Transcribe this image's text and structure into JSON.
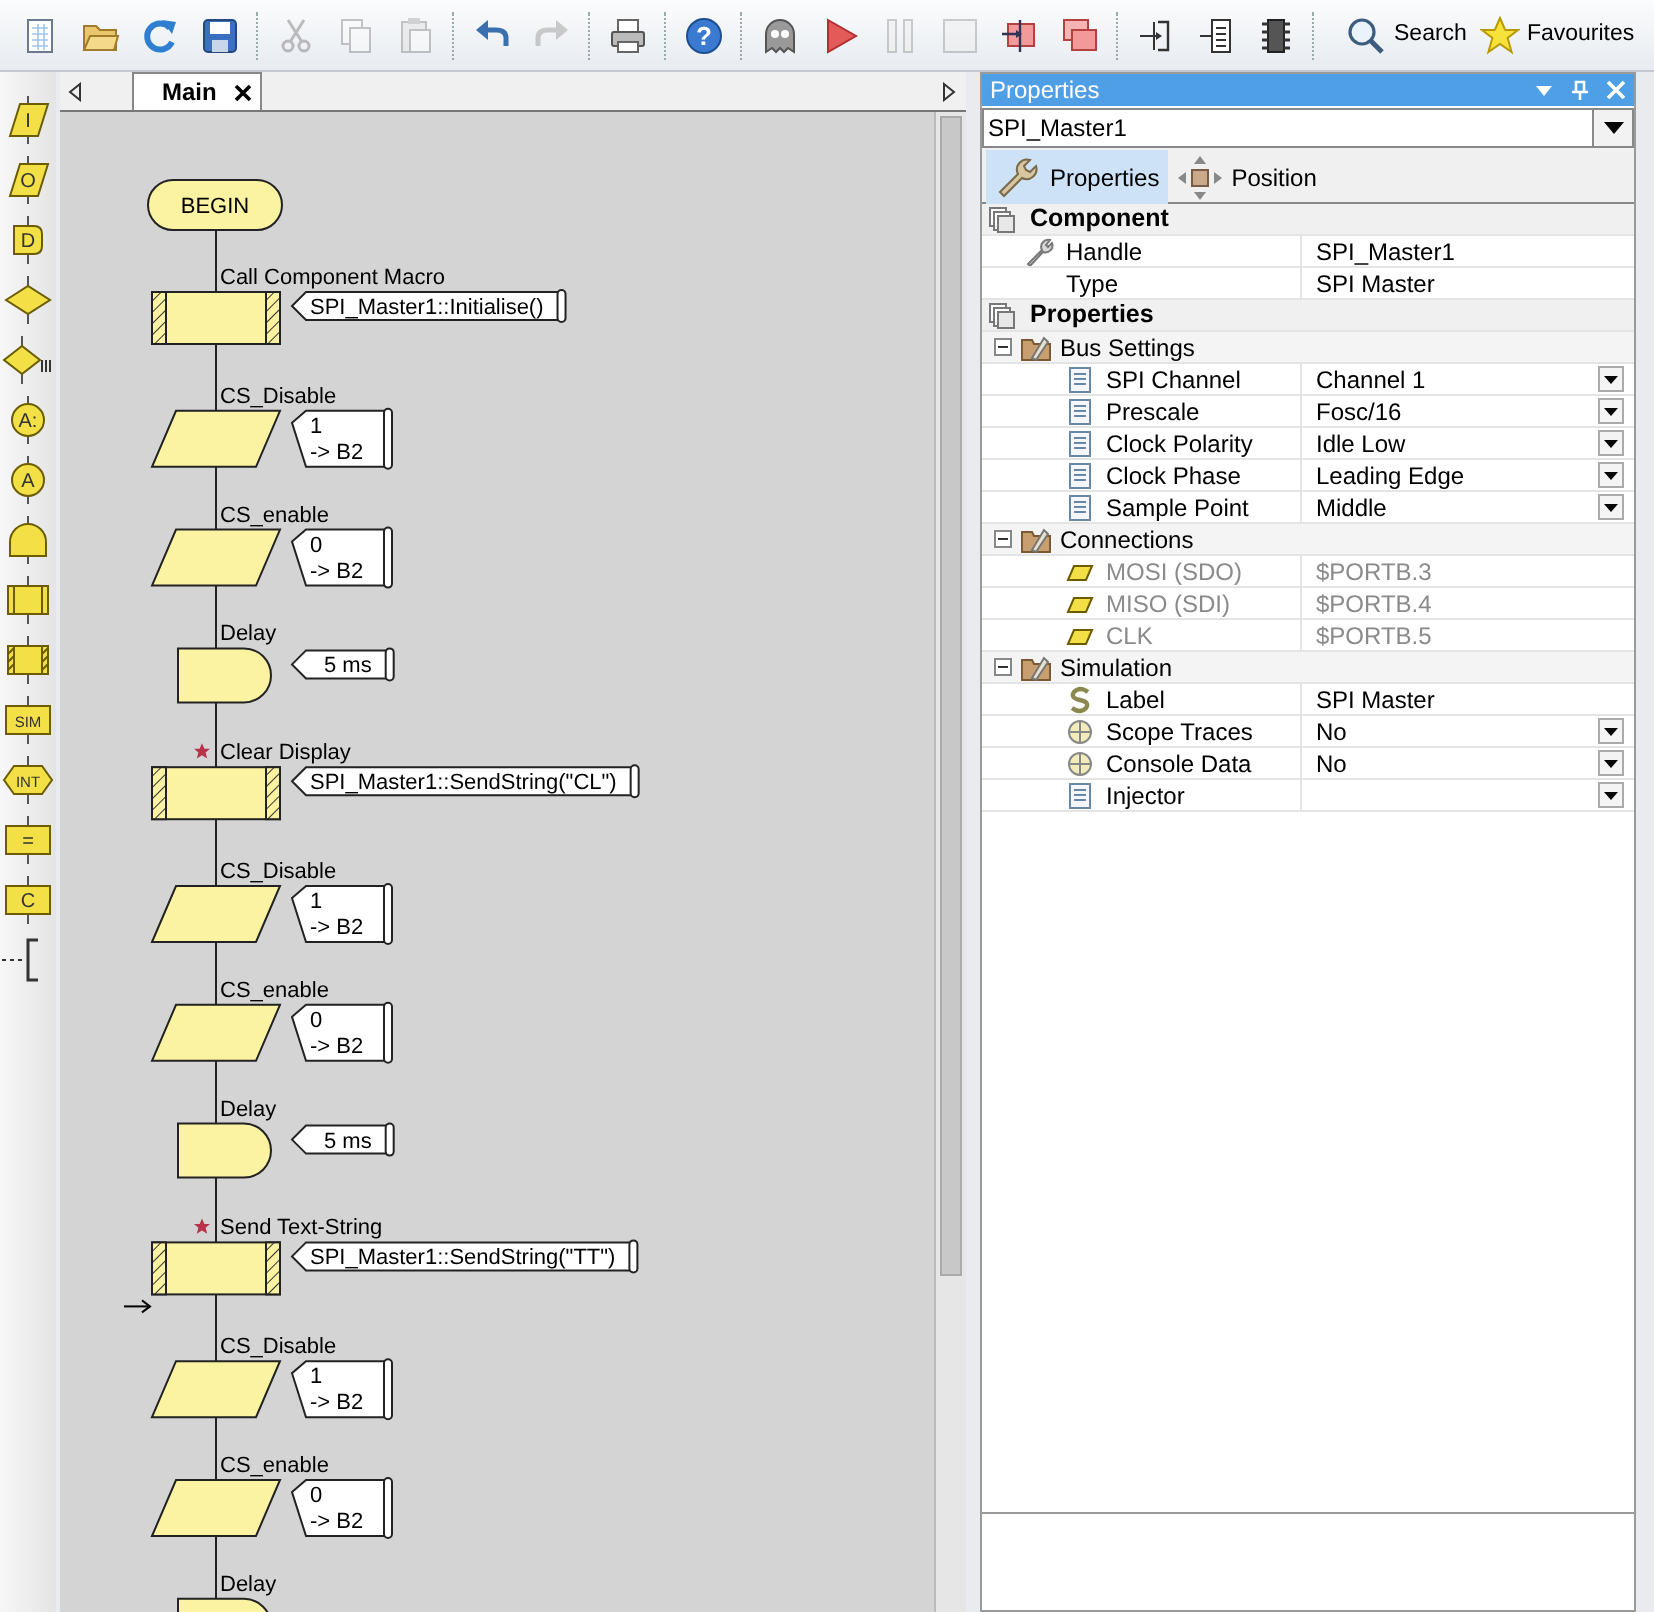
{
  "toolbar": [
    {
      "kind": "new",
      "disabled": false
    },
    {
      "kind": "open",
      "disabled": false
    },
    {
      "kind": "refresh",
      "disabled": false
    },
    {
      "kind": "save",
      "disabled": false
    },
    {
      "kind": "separator"
    },
    {
      "kind": "cut",
      "disabled": true
    },
    {
      "kind": "copy",
      "disabled": true
    },
    {
      "kind": "paste",
      "disabled": true
    },
    {
      "kind": "separator"
    },
    {
      "kind": "undo",
      "disabled": false
    },
    {
      "kind": "redo",
      "disabled": true
    },
    {
      "kind": "separator"
    },
    {
      "kind": "print",
      "disabled": false
    },
    {
      "kind": "separator"
    },
    {
      "kind": "help",
      "disabled": false,
      "glyph": "?"
    },
    {
      "kind": "separator"
    },
    {
      "kind": "ghost",
      "disabled": false
    },
    {
      "kind": "run",
      "disabled": false
    },
    {
      "kind": "pause",
      "disabled": true
    },
    {
      "kind": "stop",
      "disabled": true
    },
    {
      "kind": "step-into",
      "disabled": false
    },
    {
      "kind": "step-over",
      "disabled": false
    },
    {
      "kind": "separator"
    },
    {
      "kind": "port-in",
      "disabled": false
    },
    {
      "kind": "port-out",
      "disabled": false
    },
    {
      "kind": "chip",
      "disabled": false
    },
    {
      "kind": "separator"
    },
    {
      "kind": "search",
      "disabled": false,
      "label": "Search"
    },
    {
      "kind": "favourites",
      "disabled": false,
      "label": "Favourites"
    }
  ],
  "palette": [
    {
      "kind": "parallelogram",
      "glyph": "I"
    },
    {
      "kind": "parallelogram",
      "glyph": "O"
    },
    {
      "kind": "tag",
      "glyph": "D"
    },
    {
      "kind": "diamond"
    },
    {
      "kind": "switch"
    },
    {
      "kind": "circle",
      "glyph": "A:"
    },
    {
      "kind": "circle",
      "glyph": "A"
    },
    {
      "kind": "dome"
    },
    {
      "kind": "bars"
    },
    {
      "kind": "hatched"
    },
    {
      "kind": "box",
      "glyph": "SIM"
    },
    {
      "kind": "hexagon",
      "glyph": "INT"
    },
    {
      "kind": "box",
      "glyph": "="
    },
    {
      "kind": "box",
      "glyph": "C"
    },
    {
      "kind": "bracket"
    }
  ],
  "flowchart": {
    "tabs": [
      {
        "label": "Main",
        "selected": true
      }
    ],
    "begin": "BEGIN",
    "steps": [
      {
        "kind": "component_macro",
        "label": "Call Component Macro",
        "starred": false,
        "marker": false,
        "comment": [
          "SPI_Master1::Initialise()"
        ]
      },
      {
        "kind": "output",
        "label": "CS_Disable",
        "starred": false,
        "marker": false,
        "comment": [
          "1",
          "-> B2"
        ]
      },
      {
        "kind": "output",
        "label": "CS_enable",
        "starred": false,
        "marker": false,
        "comment": [
          "0",
          "-> B2"
        ]
      },
      {
        "kind": "delay",
        "label": "Delay",
        "starred": false,
        "marker": false,
        "comment": [
          "5 ms"
        ]
      },
      {
        "kind": "component_macro",
        "label": "Clear Display",
        "starred": true,
        "marker": false,
        "comment": [
          "SPI_Master1::SendString(\"CL\")"
        ]
      },
      {
        "kind": "output",
        "label": "CS_Disable",
        "starred": false,
        "marker": false,
        "comment": [
          "1",
          "-> B2"
        ]
      },
      {
        "kind": "output",
        "label": "CS_enable",
        "starred": false,
        "marker": false,
        "comment": [
          "0",
          "-> B2"
        ]
      },
      {
        "kind": "delay",
        "label": "Delay",
        "starred": false,
        "marker": false,
        "comment": [
          "5 ms"
        ]
      },
      {
        "kind": "component_macro",
        "label": "Send Text-String",
        "starred": true,
        "marker": true,
        "comment": [
          "SPI_Master1::SendString(\"TT\")"
        ]
      },
      {
        "kind": "output",
        "label": "CS_Disable",
        "starred": false,
        "marker": false,
        "comment": [
          "1",
          "-> B2"
        ]
      },
      {
        "kind": "output",
        "label": "CS_enable",
        "starred": false,
        "marker": false,
        "comment": [
          "0",
          "-> B2"
        ]
      },
      {
        "kind": "delay",
        "label": "Delay",
        "starred": false,
        "marker": false
      }
    ]
  },
  "properties": {
    "title": "Properties",
    "selector": "SPI_Master1",
    "tabs": [
      {
        "kind": "properties",
        "label": "Properties",
        "selected": true
      },
      {
        "kind": "position",
        "label": "Position",
        "selected": false
      }
    ],
    "sections": [
      {
        "title": "Component",
        "rows": [
          {
            "kind": "handle",
            "name": "Handle",
            "value": "SPI_Master1",
            "dropdown": false,
            "disabled": false
          },
          {
            "kind": "plain",
            "name": "Type",
            "value": "SPI Master",
            "dropdown": false,
            "disabled": false
          }
        ]
      },
      {
        "title": "Properties",
        "groups": [
          {
            "title": "Bus Settings",
            "expanded": true,
            "rows": [
              {
                "kind": "list",
                "name": "SPI Channel",
                "value": "Channel 1",
                "dropdown": true,
                "disabled": false
              },
              {
                "kind": "list",
                "name": "Prescale",
                "value": "Fosc/16",
                "dropdown": true,
                "disabled": false
              },
              {
                "kind": "list",
                "name": "Clock Polarity",
                "value": "Idle Low",
                "dropdown": true,
                "disabled": false
              },
              {
                "kind": "list",
                "name": "Clock Phase",
                "value": "Leading Edge",
                "dropdown": true,
                "disabled": false
              },
              {
                "kind": "list",
                "name": "Sample Point",
                "value": "Middle",
                "dropdown": true,
                "disabled": false
              }
            ]
          },
          {
            "title": "Connections",
            "expanded": true,
            "rows": [
              {
                "kind": "pin",
                "name": "MOSI (SDO)",
                "value": "$PORTB.3",
                "dropdown": false,
                "disabled": true
              },
              {
                "kind": "pin",
                "name": "MISO (SDI)",
                "value": "$PORTB.4",
                "dropdown": false,
                "disabled": true
              },
              {
                "kind": "pin",
                "name": "CLK",
                "value": "$PORTB.5",
                "dropdown": false,
                "disabled": true
              }
            ]
          },
          {
            "title": "Simulation",
            "expanded": true,
            "rows": [
              {
                "kind": "label",
                "name": "Label",
                "value": "SPI  Master",
                "dropdown": false,
                "disabled": false
              },
              {
                "kind": "toggle",
                "name": "Scope Traces",
                "value": "No",
                "dropdown": true,
                "disabled": false
              },
              {
                "kind": "toggle",
                "name": "Console Data",
                "value": "No",
                "dropdown": true,
                "disabled": false
              },
              {
                "kind": "list",
                "name": "Injector",
                "dropdown": true,
                "disabled": false
              }
            ]
          }
        ]
      }
    ]
  }
}
